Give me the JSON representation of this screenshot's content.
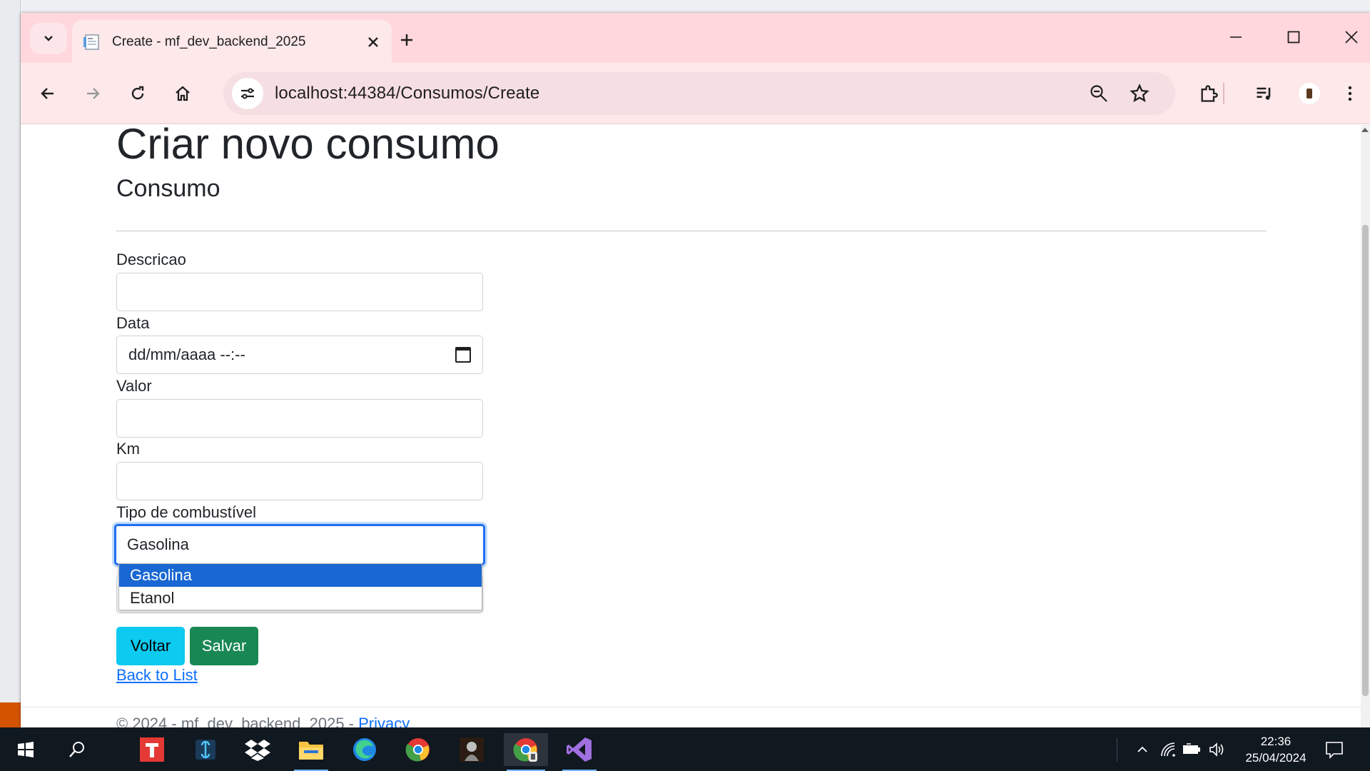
{
  "browser": {
    "tab_title": "Create - mf_dev_backend_2025",
    "url": "localhost:44384/Consumos/Create"
  },
  "page": {
    "title": "Criar novo consumo",
    "subtitle": "Consumo",
    "fields": {
      "descricao": {
        "label": "Descricao",
        "value": ""
      },
      "data": {
        "label": "Data",
        "placeholder": "dd/mm/aaaa --:--"
      },
      "valor": {
        "label": "Valor",
        "value": ""
      },
      "km": {
        "label": "Km",
        "value": ""
      },
      "tipo": {
        "label": "Tipo de combustível",
        "selected": "Gasolina",
        "options": [
          "Gasolina",
          "Etanol"
        ]
      }
    },
    "buttons": {
      "voltar": "Voltar",
      "salvar": "Salvar"
    },
    "back_link": "Back to List"
  },
  "footer": {
    "copyright": "© 2024 - mf_dev_backend_2025 - ",
    "privacy": "Privacy"
  },
  "taskbar": {
    "time": "22:36",
    "date": "25/04/2024"
  },
  "colors": {
    "tabstrip": "#ffd7dc",
    "toolbar": "#fde8ea",
    "btn_info": "#0dcaf0",
    "btn_success": "#198754",
    "focus_border": "#1f6ef0",
    "option_selected": "#1967d2"
  }
}
